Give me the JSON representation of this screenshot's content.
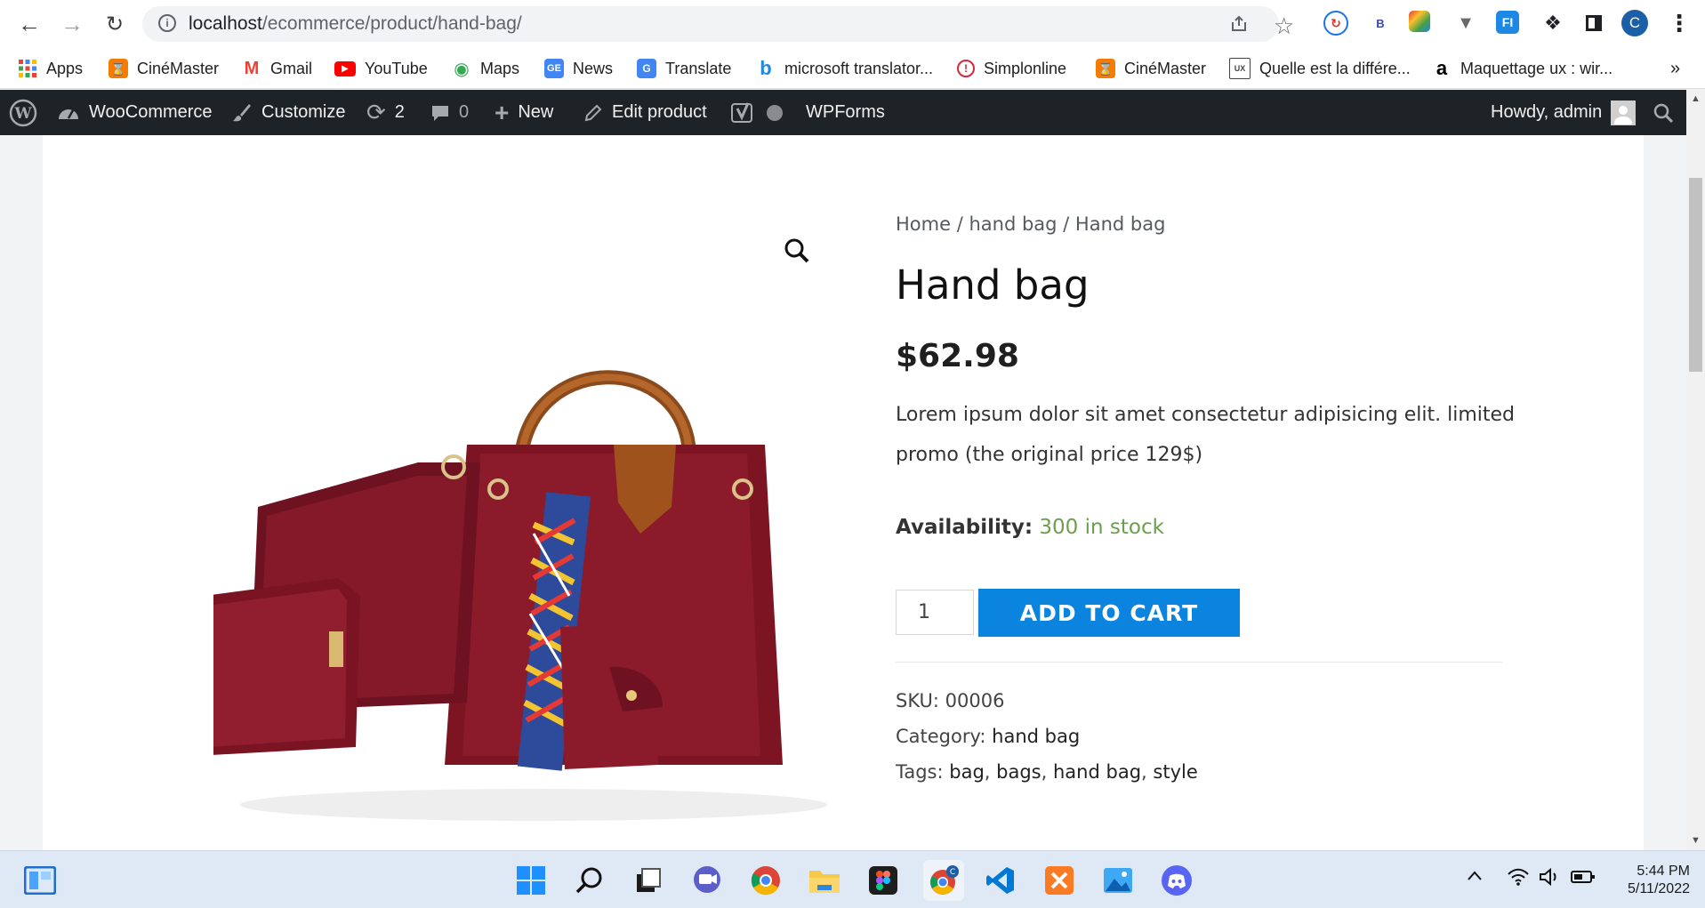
{
  "browser": {
    "url_host": "localhost",
    "url_path": "/ecommerce/product/hand-bag/",
    "extensions": [
      "translate-ext-icon",
      "b-ext-icon",
      "color-ext-icon",
      "v-ext-icon",
      "fi-ext-icon",
      "puzzle-icon",
      "sidepanel-icon"
    ],
    "profile_initial": "C"
  },
  "bookmarks": [
    {
      "label": "Apps",
      "icon": "apps-grid-icon",
      "color": "#ea4335"
    },
    {
      "label": "CinéMaster",
      "icon": "cinemaster-icon",
      "color": "#f57c00"
    },
    {
      "label": "Gmail",
      "icon": "gmail-icon",
      "color": "#ea4335"
    },
    {
      "label": "YouTube",
      "icon": "youtube-icon",
      "color": "#ff0000"
    },
    {
      "label": "Maps",
      "icon": "maps-pin-icon",
      "color": "#34a853"
    },
    {
      "label": "News",
      "icon": "news-icon",
      "color": "#4285f4"
    },
    {
      "label": "Translate",
      "icon": "translate-icon",
      "color": "#4285f4"
    },
    {
      "label": "microsoft translator...",
      "icon": "bing-icon",
      "color": "#1e88e5"
    },
    {
      "label": "Simplonline",
      "icon": "simplonline-icon",
      "color": "#d7263d"
    },
    {
      "label": "CinéMaster",
      "icon": "cinemaster-icon",
      "color": "#f57c00"
    },
    {
      "label": "Quelle est la différe...",
      "icon": "blog-ux-icon",
      "color": "#444444"
    },
    {
      "label": "Maquettage ux : wir...",
      "icon": "amazon-icon",
      "color": "#000000"
    }
  ],
  "bookmarks_overflow": "»",
  "adminbar": {
    "woocommerce": "WooCommerce",
    "customize": "Customize",
    "updates_count": "2",
    "comments_count": "0",
    "new": "New",
    "edit_product": "Edit product",
    "wpforms": "WPForms",
    "howdy": "Howdy, admin"
  },
  "product": {
    "breadcrumb": [
      "Home",
      "hand bag",
      "Hand bag"
    ],
    "breadcrumb_sep": " / ",
    "title": "Hand bag",
    "price": "$62.98",
    "description": "Lorem ipsum dolor sit amet consectetur adipisicing elit. limited promo (the original price 129$)",
    "availability_label": "Availability:",
    "availability_value": "300 in stock",
    "quantity": "1",
    "add_to_cart": "ADD TO CART",
    "sku_label": "SKU:",
    "sku": "00006",
    "category_label": "Category:",
    "category": "hand bag",
    "tags_label": "Tags:",
    "tags": [
      "bag",
      "bags",
      "hand bag",
      "style"
    ]
  },
  "taskbar": {
    "time": "5:44 PM",
    "date": "5/11/2022"
  },
  "colors": {
    "admin_bar": "#1d2327",
    "add_to_cart": "#0b84e0",
    "in_stock": "#6b9f4f",
    "bag": "#8b1a2b"
  }
}
